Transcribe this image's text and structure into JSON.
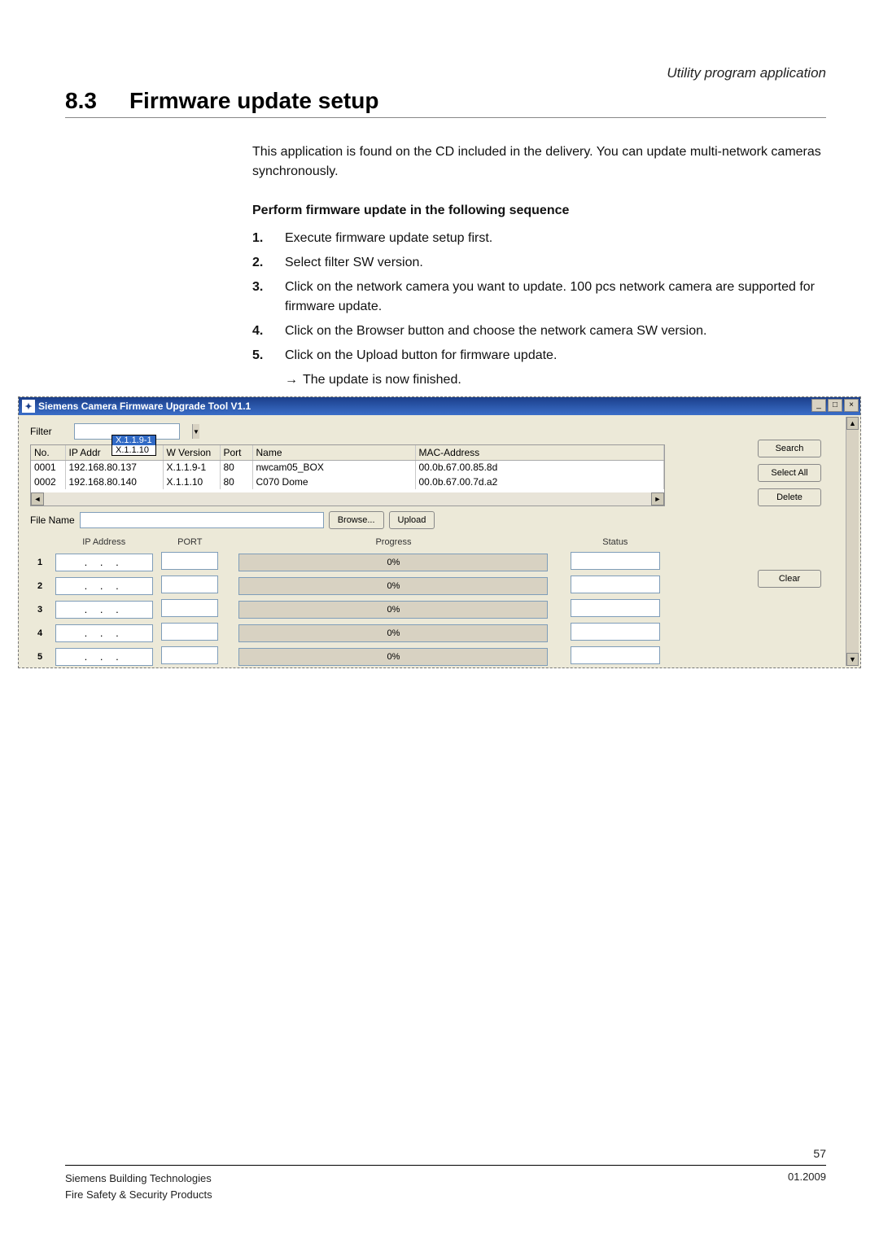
{
  "breadcrumb": "Utility program application",
  "section_num": "8.3",
  "section_title": "Firmware update setup",
  "intro": "This application is found on the CD included in the delivery. You can update multi-network cameras synchronously.",
  "subheading": "Perform firmware update in the following sequence",
  "steps": [
    {
      "n": "1.",
      "t": "Execute firmware update setup first."
    },
    {
      "n": "2.",
      "t": "Select filter SW version."
    },
    {
      "n": "3.",
      "t": "Click on the network camera you want to update. 100 pcs network camera are supported for firmware update."
    },
    {
      "n": "4.",
      "t": "Click on the Browser button and choose the network camera SW version."
    },
    {
      "n": "5.",
      "t": "Click on the Upload button for firmware update."
    }
  ],
  "result_arrow": "→",
  "result_text": "The update is now finished.",
  "app": {
    "title": "Siemens Camera Firmware Upgrade Tool V1.1",
    "min": "_",
    "max": "□",
    "close": "×",
    "filter_label": "Filter",
    "filter_options": [
      "X.1.1.9-1",
      "X.1.1.10"
    ],
    "headers": {
      "no": "No.",
      "ip": "IP Addr",
      "ver": "W Version",
      "port": "Port",
      "name": "Name",
      "mac": "MAC-Address"
    },
    "rows": [
      {
        "no": "0001",
        "ip": "192.168.80.137",
        "ver": "X.1.1.9-1",
        "port": "80",
        "name": "nwcam05_BOX",
        "mac": "00.0b.67.00.85.8d"
      },
      {
        "no": "0002",
        "ip": "192.168.80.140",
        "ver": "X.1.1.10",
        "port": "80",
        "name": "C070 Dome",
        "mac": "00.0b.67.00.7d.a2"
      }
    ],
    "btn_search": "Search",
    "btn_selectall": "Select All",
    "btn_delete": "Delete",
    "btn_clear": "Clear",
    "file_label": "File Name",
    "btn_browse": "Browse...",
    "btn_upload": "Upload",
    "upload_headers": {
      "ip": "IP Address",
      "port": "PORT",
      "prog": "Progress",
      "status": "Status"
    },
    "upload_rows": [
      {
        "n": "1",
        "ip": ".   .   .",
        "prog": "0%"
      },
      {
        "n": "2",
        "ip": ".   .   .",
        "prog": "0%"
      },
      {
        "n": "3",
        "ip": ".   .   .",
        "prog": "0%"
      },
      {
        "n": "4",
        "ip": ".   .   .",
        "prog": "0%"
      },
      {
        "n": "5",
        "ip": ".   .   .",
        "prog": "0%"
      }
    ]
  },
  "footer": {
    "page": "57",
    "left1": "Siemens Building Technologies",
    "left2": "Fire Safety & Security Products",
    "date": "01.2009"
  }
}
